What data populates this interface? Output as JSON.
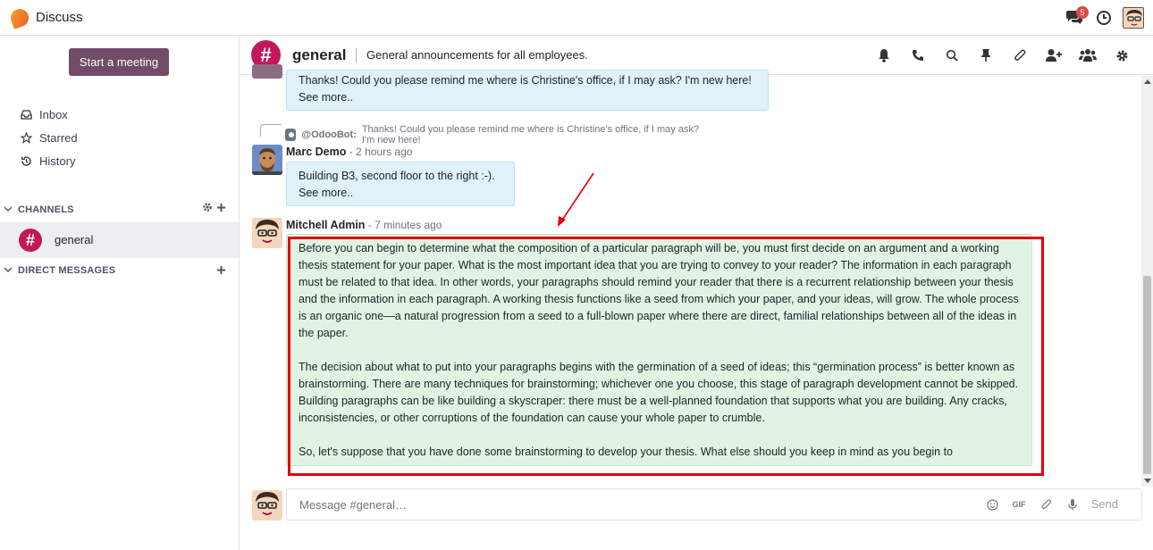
{
  "navbar": {
    "app_title": "Discuss",
    "chat_badge": "5",
    "icons": [
      "app-logo-icon",
      "chat-icon",
      "clock-icon",
      "user-avatar"
    ]
  },
  "sidebar": {
    "meeting_button": "Start a meeting",
    "mailboxes": [
      {
        "label": "Inbox",
        "icon": "inbox-icon"
      },
      {
        "label": "Starred",
        "icon": "star-icon"
      },
      {
        "label": "History",
        "icon": "history-icon"
      }
    ],
    "channels_header": "CHANNELS",
    "channels": [
      {
        "label": "general"
      }
    ],
    "dm_header": "DIRECT MESSAGES"
  },
  "thread": {
    "name": "general",
    "description": "General announcements for all employees.",
    "header_icons": [
      "bell-icon",
      "phone-icon",
      "search-icon",
      "pin-icon",
      "paperclip-icon",
      "add-user-icon",
      "members-icon",
      "gear-icon"
    ]
  },
  "messages": {
    "first_bubble": "Thanks! Could you please remind me where is Christine's office, if I may ask? I'm new here!",
    "see_more": "See more..",
    "reply": {
      "author": "@OdooBot:",
      "text": "Thanks! Could you please remind me where is Christine's office, if I may ask? I'm new here!"
    },
    "marc": {
      "author": "Marc Demo",
      "time": " - 2 hours ago",
      "text": "Building B3, second floor to the right :-)."
    },
    "mitchell": {
      "author": "Mitchell Admin",
      "time": " - 7 minutes ago",
      "p1": "Before you can begin to determine what the composition of a particular paragraph will be, you must first decide on an argument and a working thesis statement for your paper. What is the most important idea that you are trying to convey to your reader? The information in each paragraph must be related to that idea. In other words, your paragraphs should remind your reader that there is a recurrent relationship between your thesis and the information in each paragraph. A working thesis functions like a seed from which your paper, and your ideas, will grow. The whole process is an organic one—a natural progression from a seed to a full-blown paper where there are direct, familial relationships between all of the ideas in the paper.",
      "p2": "The decision about what to put into your paragraphs begins with the germination of a seed of ideas; this “germination process” is better known as brainstorming. There are many techniques for brainstorming; whichever one you choose, this stage of paragraph development cannot be skipped. Building paragraphs can be like building a skyscraper: there must be a well-planned foundation that supports what you are building. Any cracks, inconsistencies, or other corruptions of the foundation can cause your whole paper to crumble.",
      "p3": "So, let's suppose that you have done some brainstorming to develop your thesis. What else should you keep in mind as you begin to"
    }
  },
  "composer": {
    "placeholder": "Message #general…",
    "tools": [
      "emoji-icon",
      "gif-icon",
      "paperclip-icon",
      "microphone-icon"
    ],
    "gif_label": "GIF",
    "send_label": "Send"
  },
  "colors": {
    "brand": "#714b67",
    "channel": "#c2185b",
    "highlight": "#e0000a",
    "bubble_blue": "#e0f2f8",
    "bubble_green": "#e1f4e4"
  }
}
